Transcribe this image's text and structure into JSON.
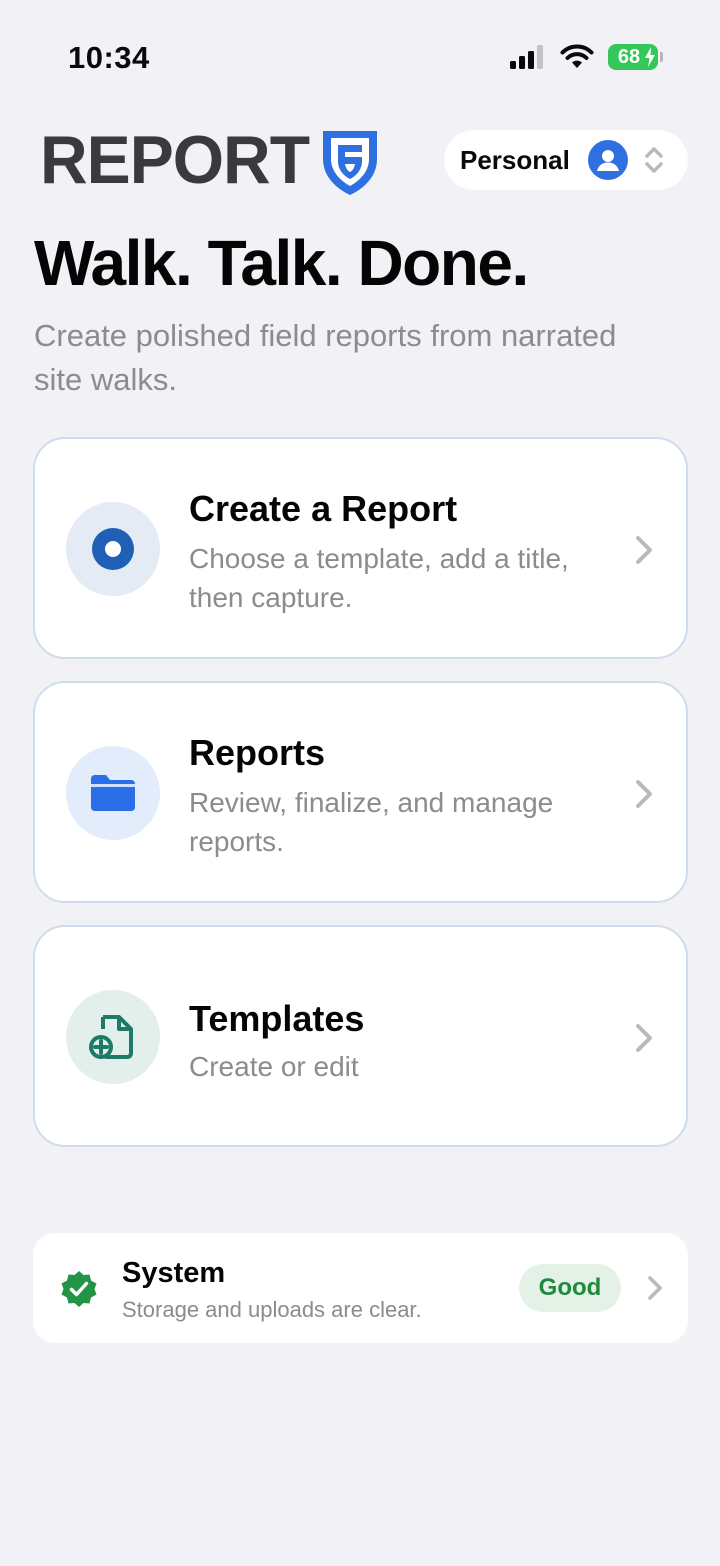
{
  "status_bar": {
    "time": "10:34",
    "battery_level": "68",
    "icons": [
      "signal-icon",
      "wifi-icon",
      "battery-icon"
    ]
  },
  "header": {
    "logo_text": "REPORT",
    "logo_icon": "shield-icon",
    "account": {
      "label": "Personal",
      "icon": "avatar-icon",
      "switch_icon": "chevron-up-down-icon"
    }
  },
  "hero": {
    "title": "Walk. Talk. Done.",
    "subtitle": "Create polished field reports from narrated site walks."
  },
  "cards": [
    {
      "title": "Create a Report",
      "description": "Choose a template, add a title, then capture.",
      "icon": "record-icon",
      "icon_color": "#1f5fb5",
      "icon_bg": "#e4ebf5"
    },
    {
      "title": "Reports",
      "description": "Review, finalize, and manage reports.",
      "icon": "folder-icon",
      "icon_color": "#2a6fe8",
      "icon_bg": "#e3ecfb"
    },
    {
      "title": "Templates",
      "description": "Create or edit",
      "icon": "document-add-icon",
      "icon_color": "#1e7a66",
      "icon_bg": "#e2efeb"
    }
  ],
  "system": {
    "title": "System",
    "description": "Storage and uploads are clear.",
    "status": "Good",
    "icon": "verified-check-icon",
    "status_color": "#1f8a3b",
    "status_bg": "#e3f1e6"
  },
  "colors": {
    "background": "#f1f1f6",
    "brand_blue": "#2f6fe0",
    "logo_gray": "#3a3a3d",
    "muted_text": "#8b8b90",
    "card_border": "#cfdcee"
  }
}
